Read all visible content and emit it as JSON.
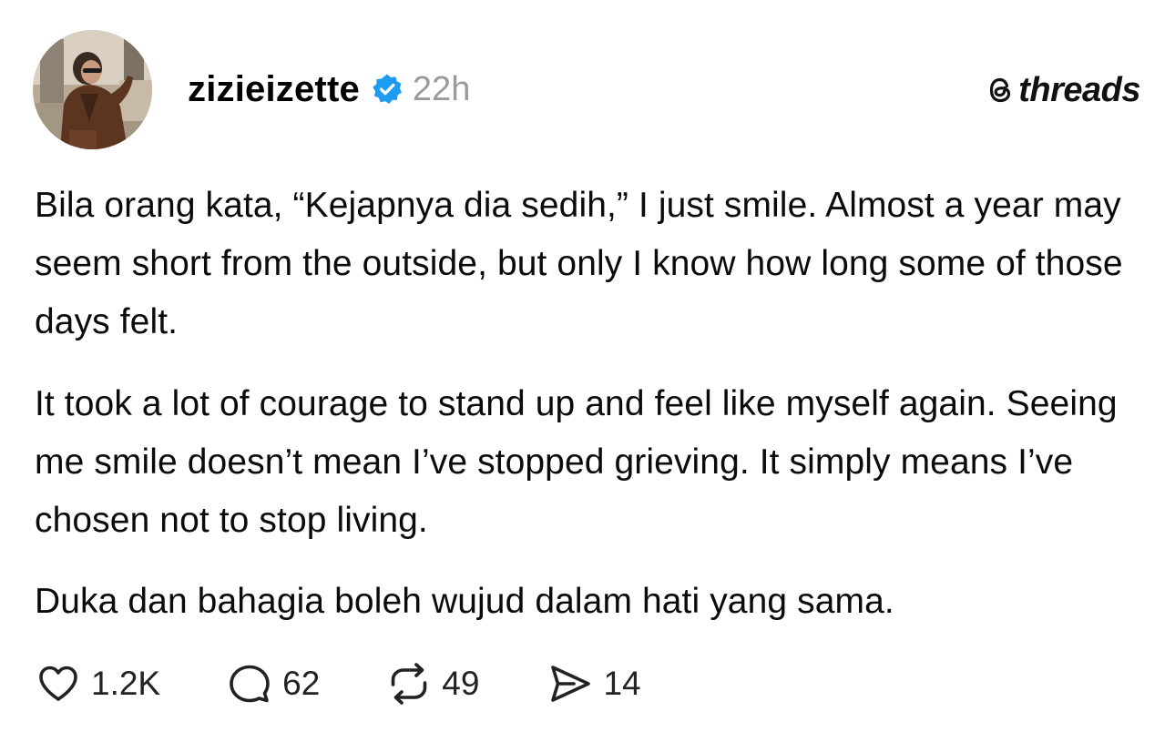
{
  "post": {
    "username": "zizieizette",
    "verified": true,
    "time": "22h",
    "paragraphs": [
      "Bila orang kata, “Kejapnya dia sedih,” I just smile. Almost a year may seem short from the outside, but only I know how long some of those days felt.",
      "It took a lot of courage to stand up and feel like myself again. Seeing me smile doesn’t mean I’ve stopped grieving. It simply means I’ve chosen not to stop living.",
      "Duka dan bahagia boleh wujud dalam hati yang sama."
    ]
  },
  "brand": {
    "icon": "threads-logo-icon",
    "name": "threads"
  },
  "actions": {
    "likes": "1.2K",
    "replies": "62",
    "reposts": "49",
    "shares": "14"
  },
  "colors": {
    "verified_badge": "#1d9bf0",
    "timestamp": "#9a9a9a",
    "text": "#000000",
    "background": "#ffffff"
  },
  "icons": {
    "like": "heart-icon",
    "reply": "speech-bubble-icon",
    "repost": "repost-arrows-icon",
    "share": "send-arrow-icon",
    "verified": "verified-badge-icon"
  }
}
